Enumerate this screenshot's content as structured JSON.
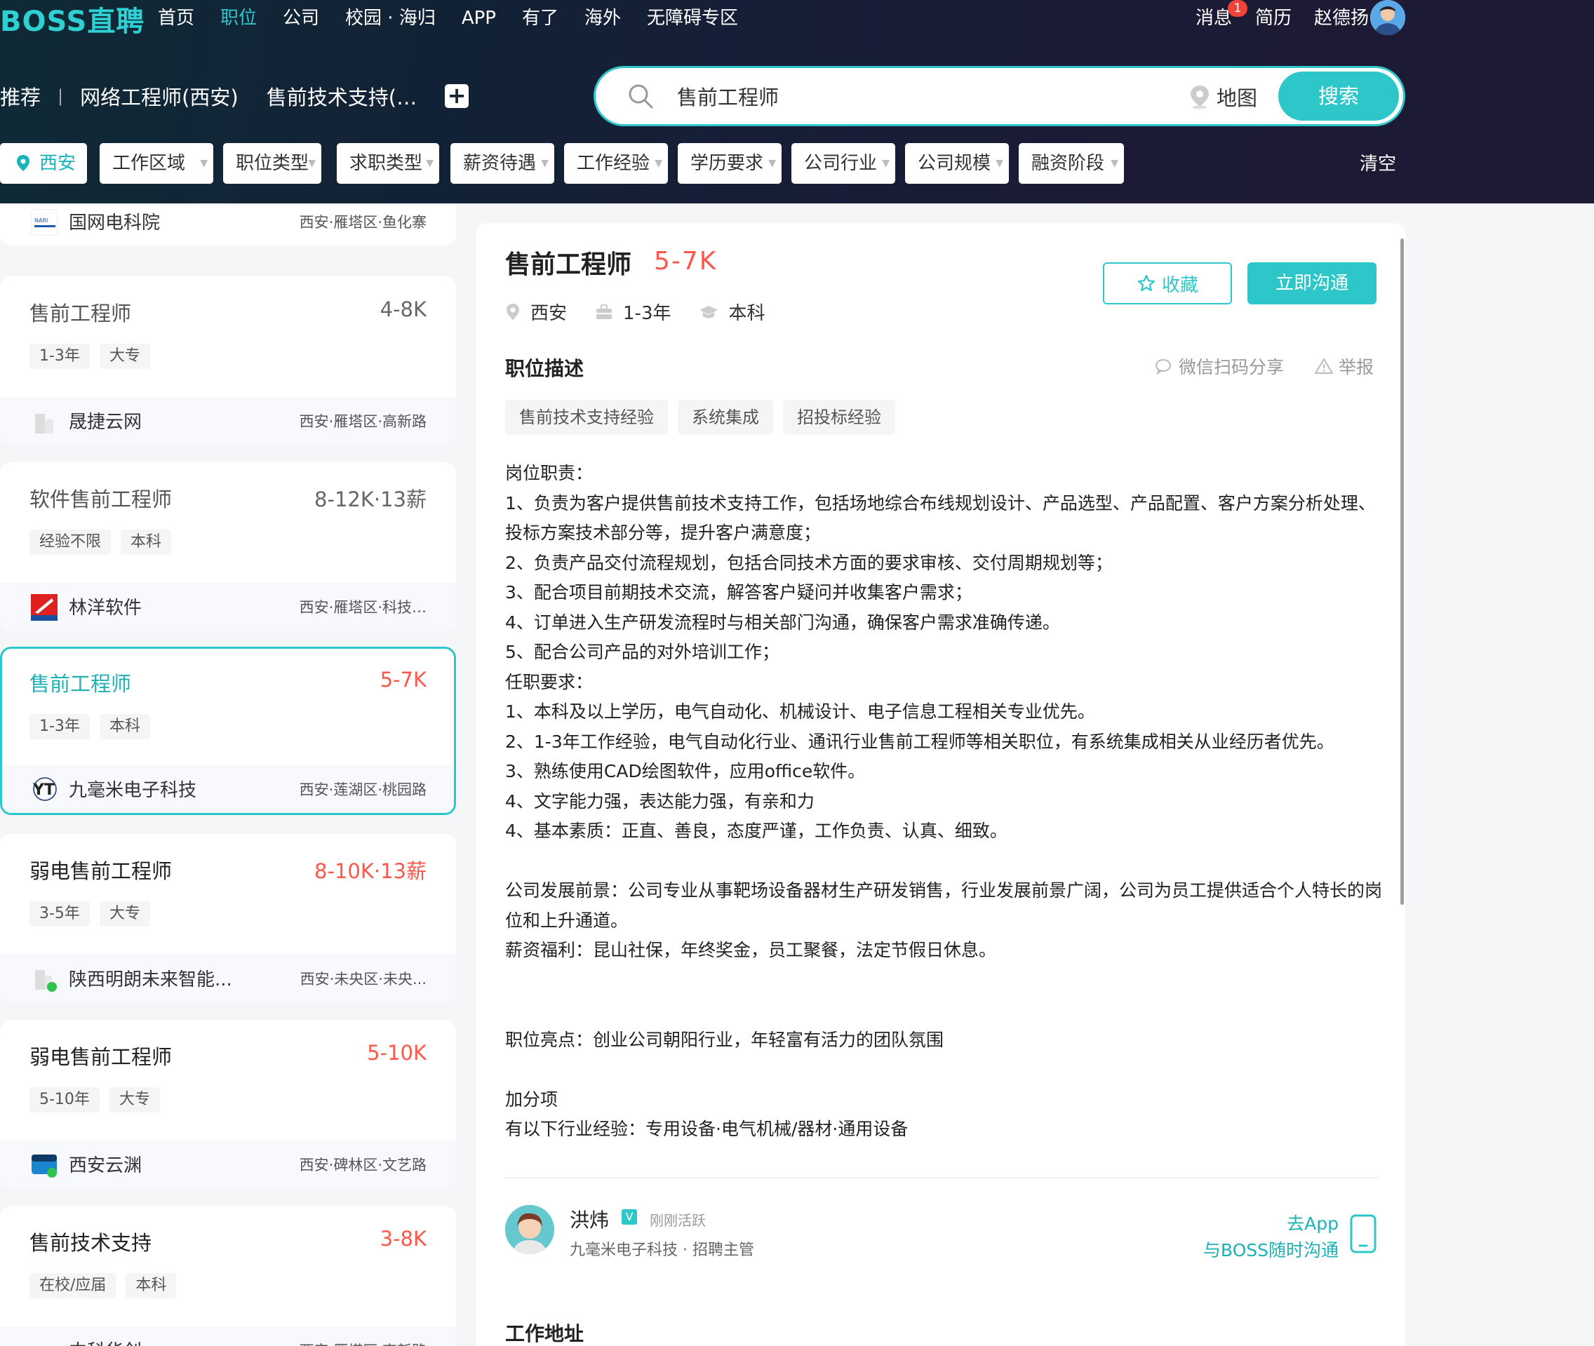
{
  "header": {
    "logo": "BOSS直聘",
    "nav": [
      "首页",
      "职位",
      "公司",
      "校园 · 海归",
      "APP",
      "有了",
      "海外",
      "无障碍专区"
    ],
    "active_nav": "职位",
    "messages_label": "消息",
    "messages_badge": "1",
    "resume_label": "简历",
    "username": "赵德扬"
  },
  "subnav": {
    "items": [
      "推荐",
      "|",
      "网络工程师(西安)",
      "售前技术支持(…"
    ]
  },
  "search": {
    "value": "售前工程师",
    "map_label": "地图",
    "button_label": "搜索"
  },
  "filters": {
    "city": "西安",
    "items": [
      "工作区域",
      "职位类型",
      "求职类型",
      "薪资待遇",
      "工作经验",
      "学历要求",
      "公司行业",
      "公司规模",
      "融资阶段"
    ],
    "clear_label": "清空"
  },
  "jobs": [
    {
      "title": "",
      "salary": "",
      "tags": [],
      "company": "国网电科院",
      "address": "西安·雁塔区·鱼化寨"
    },
    {
      "title": "售前工程师",
      "salary": "4-8K",
      "tags": [
        "1-3年",
        "大专"
      ],
      "company": "晟捷云网",
      "address": "西安·雁塔区·高新路"
    },
    {
      "title": "软件售前工程师",
      "salary": "8-12K·13薪",
      "tags": [
        "经验不限",
        "本科"
      ],
      "company": "林洋软件",
      "address": "西安·雁塔区·科技…"
    },
    {
      "title": "售前工程师",
      "salary": "5-7K",
      "tags": [
        "1-3年",
        "本科"
      ],
      "company": "九毫米电子科技",
      "address": "西安·莲湖区·桃园路"
    },
    {
      "title": "弱电售前工程师",
      "salary": "8-10K·13薪",
      "tags": [
        "3-5年",
        "大专"
      ],
      "company": "陕西明朗未来智能...",
      "address": "西安·未央区·未央..."
    },
    {
      "title": "弱电售前工程师",
      "salary": "5-10K",
      "tags": [
        "5-10年",
        "大专"
      ],
      "company": "西安云渊",
      "address": "西安·碑林区·文艺路"
    },
    {
      "title": "售前技术支持",
      "salary": "3-8K",
      "tags": [
        "在校/应届",
        "本科"
      ],
      "company": "中科华创",
      "address": "西安·雁塔区·高新路"
    }
  ],
  "detail": {
    "title": "售前工程师",
    "salary": "5-7K",
    "city": "西安",
    "experience": "1-3年",
    "degree": "本科",
    "fav_label": "收藏",
    "chat_label": "立即沟通",
    "section_title": "职位描述",
    "share_label": "微信扫码分享",
    "report_label": "举报",
    "tags": [
      "售前技术支持经验",
      "系统集成",
      "招投标经验"
    ],
    "description": [
      "岗位职责：",
      "1、负责为客户提供售前技术支持工作，包括场地综合布线规划设计、产品选型、产品配置、客户方案分析处理、",
      "投标方案技术部分等，提升客户满意度；",
      "2、负责产品交付流程规划，包括合同技术方面的要求审核、交付周期规划等；",
      "3、配合项目前期技术交流，解答客户疑问并收集客户需求；",
      "4、订单进入生产研发流程时与相关部门沟通，确保客户需求准确传递。",
      "5、配合公司产品的对外培训工作；",
      "任职要求：",
      "1、本科及以上学历，电气自动化、机械设计、电子信息工程相关专业优先。",
      "2、1-3年工作经验，电气自动化行业、通讯行业售前工程师等相关职位，有系统集成相关从业经历者优先。",
      "3、熟练使用CAD绘图软件，应用office软件。",
      "4、文字能力强，表达能力强，有亲和力",
      "4、基本素质：正直、善良，态度严谨，工作负责、认真、细致。",
      "",
      "公司发展前景：公司专业从事靶场设备器材生产研发销售，行业发展前景广阔，公司为员工提供适合个人特长的岗",
      "位和上升通道。",
      "薪资福利：昆山社保，年终奖金，员工聚餐，法定节假日休息。",
      "",
      "",
      "职位亮点：创业公司朝阳行业，年轻富有活力的团队氛围",
      "",
      "加分项",
      "有以下行业经验：专用设备·电气机械/器材·通用设备"
    ],
    "recruiter": {
      "name": "洪炜",
      "verified": "V",
      "status": "刚刚活跃",
      "company_role": "九毫米电子科技 · 招聘主管"
    },
    "goapp_line1": "去App",
    "goapp_line2": "与BOSS随时沟通",
    "address_title": "工作地址"
  },
  "colors": {
    "accent": "#2ec7c9",
    "salary": "#fe574a",
    "header_bg": "#132036"
  }
}
